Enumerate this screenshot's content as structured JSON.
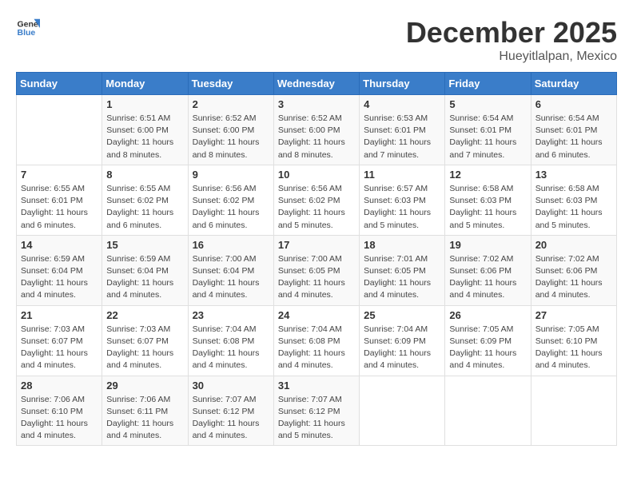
{
  "header": {
    "logo": {
      "general": "General",
      "blue": "Blue"
    },
    "title": "December 2025",
    "location": "Hueyitlalpan, Mexico"
  },
  "weekdays": [
    "Sunday",
    "Monday",
    "Tuesday",
    "Wednesday",
    "Thursday",
    "Friday",
    "Saturday"
  ],
  "weeks": [
    [
      {
        "day": "",
        "info": ""
      },
      {
        "day": "1",
        "info": "Sunrise: 6:51 AM\nSunset: 6:00 PM\nDaylight: 11 hours\nand 8 minutes."
      },
      {
        "day": "2",
        "info": "Sunrise: 6:52 AM\nSunset: 6:00 PM\nDaylight: 11 hours\nand 8 minutes."
      },
      {
        "day": "3",
        "info": "Sunrise: 6:52 AM\nSunset: 6:00 PM\nDaylight: 11 hours\nand 8 minutes."
      },
      {
        "day": "4",
        "info": "Sunrise: 6:53 AM\nSunset: 6:01 PM\nDaylight: 11 hours\nand 7 minutes."
      },
      {
        "day": "5",
        "info": "Sunrise: 6:54 AM\nSunset: 6:01 PM\nDaylight: 11 hours\nand 7 minutes."
      },
      {
        "day": "6",
        "info": "Sunrise: 6:54 AM\nSunset: 6:01 PM\nDaylight: 11 hours\nand 6 minutes."
      }
    ],
    [
      {
        "day": "7",
        "info": "Sunrise: 6:55 AM\nSunset: 6:01 PM\nDaylight: 11 hours\nand 6 minutes."
      },
      {
        "day": "8",
        "info": "Sunrise: 6:55 AM\nSunset: 6:02 PM\nDaylight: 11 hours\nand 6 minutes."
      },
      {
        "day": "9",
        "info": "Sunrise: 6:56 AM\nSunset: 6:02 PM\nDaylight: 11 hours\nand 6 minutes."
      },
      {
        "day": "10",
        "info": "Sunrise: 6:56 AM\nSunset: 6:02 PM\nDaylight: 11 hours\nand 5 minutes."
      },
      {
        "day": "11",
        "info": "Sunrise: 6:57 AM\nSunset: 6:03 PM\nDaylight: 11 hours\nand 5 minutes."
      },
      {
        "day": "12",
        "info": "Sunrise: 6:58 AM\nSunset: 6:03 PM\nDaylight: 11 hours\nand 5 minutes."
      },
      {
        "day": "13",
        "info": "Sunrise: 6:58 AM\nSunset: 6:03 PM\nDaylight: 11 hours\nand 5 minutes."
      }
    ],
    [
      {
        "day": "14",
        "info": "Sunrise: 6:59 AM\nSunset: 6:04 PM\nDaylight: 11 hours\nand 4 minutes."
      },
      {
        "day": "15",
        "info": "Sunrise: 6:59 AM\nSunset: 6:04 PM\nDaylight: 11 hours\nand 4 minutes."
      },
      {
        "day": "16",
        "info": "Sunrise: 7:00 AM\nSunset: 6:04 PM\nDaylight: 11 hours\nand 4 minutes."
      },
      {
        "day": "17",
        "info": "Sunrise: 7:00 AM\nSunset: 6:05 PM\nDaylight: 11 hours\nand 4 minutes."
      },
      {
        "day": "18",
        "info": "Sunrise: 7:01 AM\nSunset: 6:05 PM\nDaylight: 11 hours\nand 4 minutes."
      },
      {
        "day": "19",
        "info": "Sunrise: 7:02 AM\nSunset: 6:06 PM\nDaylight: 11 hours\nand 4 minutes."
      },
      {
        "day": "20",
        "info": "Sunrise: 7:02 AM\nSunset: 6:06 PM\nDaylight: 11 hours\nand 4 minutes."
      }
    ],
    [
      {
        "day": "21",
        "info": "Sunrise: 7:03 AM\nSunset: 6:07 PM\nDaylight: 11 hours\nand 4 minutes."
      },
      {
        "day": "22",
        "info": "Sunrise: 7:03 AM\nSunset: 6:07 PM\nDaylight: 11 hours\nand 4 minutes."
      },
      {
        "day": "23",
        "info": "Sunrise: 7:04 AM\nSunset: 6:08 PM\nDaylight: 11 hours\nand 4 minutes."
      },
      {
        "day": "24",
        "info": "Sunrise: 7:04 AM\nSunset: 6:08 PM\nDaylight: 11 hours\nand 4 minutes."
      },
      {
        "day": "25",
        "info": "Sunrise: 7:04 AM\nSunset: 6:09 PM\nDaylight: 11 hours\nand 4 minutes."
      },
      {
        "day": "26",
        "info": "Sunrise: 7:05 AM\nSunset: 6:09 PM\nDaylight: 11 hours\nand 4 minutes."
      },
      {
        "day": "27",
        "info": "Sunrise: 7:05 AM\nSunset: 6:10 PM\nDaylight: 11 hours\nand 4 minutes."
      }
    ],
    [
      {
        "day": "28",
        "info": "Sunrise: 7:06 AM\nSunset: 6:10 PM\nDaylight: 11 hours\nand 4 minutes."
      },
      {
        "day": "29",
        "info": "Sunrise: 7:06 AM\nSunset: 6:11 PM\nDaylight: 11 hours\nand 4 minutes."
      },
      {
        "day": "30",
        "info": "Sunrise: 7:07 AM\nSunset: 6:12 PM\nDaylight: 11 hours\nand 4 minutes."
      },
      {
        "day": "31",
        "info": "Sunrise: 7:07 AM\nSunset: 6:12 PM\nDaylight: 11 hours\nand 5 minutes."
      },
      {
        "day": "",
        "info": ""
      },
      {
        "day": "",
        "info": ""
      },
      {
        "day": "",
        "info": ""
      }
    ]
  ]
}
